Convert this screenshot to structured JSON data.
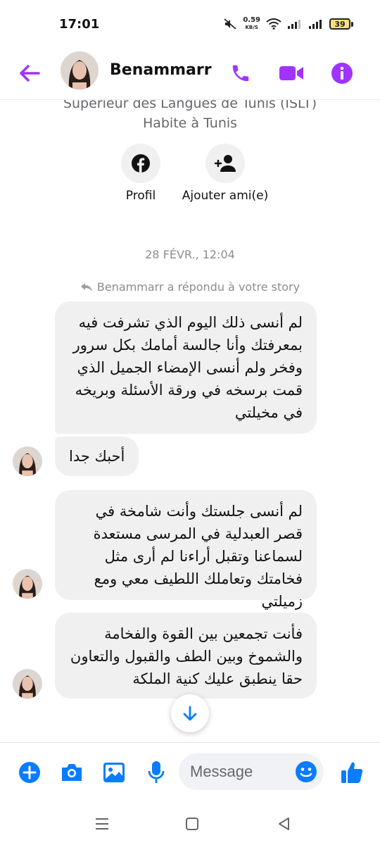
{
  "status": {
    "time": "17:01",
    "net_speed": "0.59",
    "net_unit": "KB/S",
    "battery": "39"
  },
  "header": {
    "name": "Benammarr"
  },
  "profile": {
    "school": "Supérieur des Langues de Tunis (ISLT)",
    "location": "Habite à Tunis",
    "profile_label": "Profil",
    "add_friend_label": "Ajouter ami(e)"
  },
  "conversation": {
    "timestamp": "28 FÉVR., 12:04",
    "story_reply": "Benammarr a répondu à votre story",
    "messages": [
      {
        "text": "لم أنسى ذلك اليوم الذي تشرفت فيه بمعرفتك وأنا جالسة أمامك بكل سرور وفخر ولم أنسى الإمضاء الجميل الذي قمت برسخه في ورقة الأسئلة وبريخه في مخيلتي"
      },
      {
        "text": "أحبك جدا"
      },
      {
        "text": "لم أنسى جلستك وأنت شامخة في قصر العبدلية في المرسى مستعدة لسماعنا وتقبل أراءنا  لم أرى مثل فخامتك وتعاملك اللطيف معي ومع زميلتي"
      },
      {
        "text": "فأنت تجمعين بين القوة والفخامة والشموخ وبين الطف والقبول والتعاون حقا ينطبق عليك كنية الملكة"
      }
    ]
  },
  "composer": {
    "placeholder": "Message"
  },
  "colors": {
    "accent_purple": "#a033ff",
    "accent_blue": "#0a7cff",
    "bubble_gray": "#f0f0f0"
  }
}
